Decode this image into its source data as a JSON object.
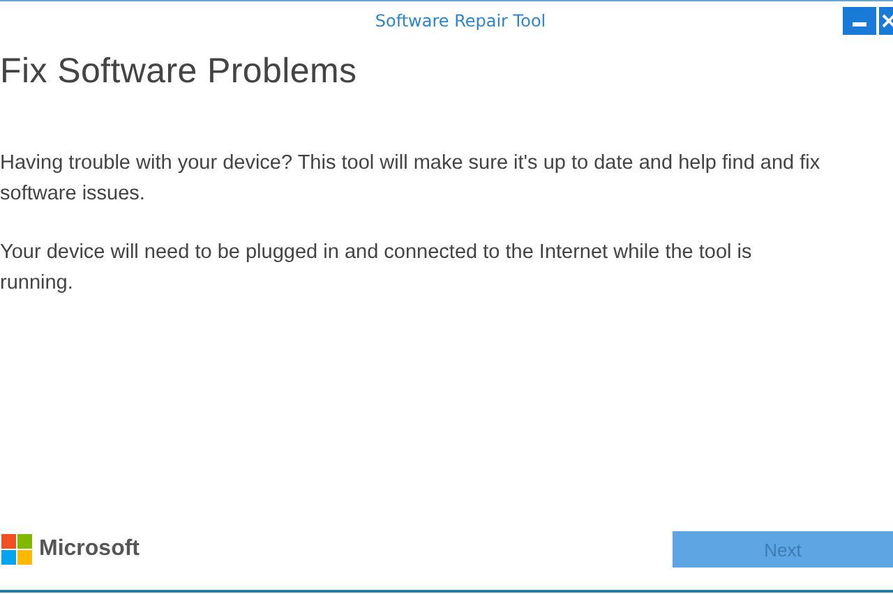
{
  "window": {
    "title": "Software Repair Tool"
  },
  "heading": "Fix Software Problems",
  "paragraphs": [
    "Having trouble with your device? This tool will make sure it's up to date and help find and fix software issues.",
    "Your device will need to be plugged in and connected to the Internet while the tool is running."
  ],
  "brand": "Microsoft",
  "buttons": [
    {
      "label": "Next",
      "disabled": true
    }
  ]
}
